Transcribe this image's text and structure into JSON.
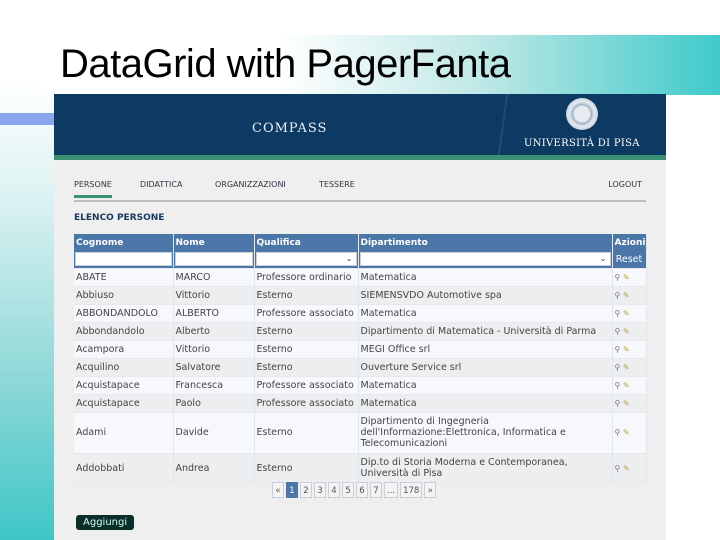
{
  "slide": {
    "title": "DataGrid with PagerFanta"
  },
  "header": {
    "brand": "COMPASS",
    "university": "UNIVERSITÀ DI PISA"
  },
  "nav": {
    "items": [
      "PERSONE",
      "DIDATTICA",
      "ORGANIZZAZIONI",
      "TESSERE"
    ],
    "logout": "LOGOUT"
  },
  "section_title": "ELENCO PERSONE",
  "table": {
    "columns": [
      "Cognome",
      "Nome",
      "Qualifica",
      "Dipartimento",
      "Azioni"
    ],
    "reset_label": "Reset",
    "rows": [
      [
        "ABATE",
        "MARCO",
        "Professore ordinario",
        "Matematica"
      ],
      [
        "Abbiuso",
        "Vittorio",
        "Esterno",
        "SIEMENSVDO Automotive spa"
      ],
      [
        "ABBONDANDOLO",
        "ALBERTO",
        "Professore associato",
        "Matematica"
      ],
      [
        "Abbondandolo",
        "Alberto",
        "Esterno",
        "Dipartimento di Matematica - Università di Parma"
      ],
      [
        "Acampora",
        "Vittorio",
        "Esterno",
        "MEGI Office srl"
      ],
      [
        "Acquilino",
        "Salvatore",
        "Esterno",
        "Ouverture Service srl"
      ],
      [
        "Acquistapace",
        "Francesca",
        "Professore associato",
        "Matematica"
      ],
      [
        "Acquistapace",
        "Paolo",
        "Professore associato",
        "Matematica"
      ],
      [
        "Adami",
        "Davide",
        "Esterno",
        "Dipartimento di Ingegneria dell'Informazione:Elettronica, Informatica e Telecomunicazioni"
      ],
      [
        "Addobbati",
        "Andrea",
        "Esterno",
        "Dip.to di Storia Moderna e Contemporanea, Università di Pisa"
      ]
    ]
  },
  "pager": {
    "prev": "«",
    "pages": [
      "1",
      "2",
      "3",
      "4",
      "5",
      "6",
      "7",
      "...",
      "178"
    ],
    "next": "»",
    "current": "1"
  },
  "add_button": "Aggiungi",
  "icons": {
    "view": "magnifier-icon",
    "edit": "pencil-icon"
  }
}
